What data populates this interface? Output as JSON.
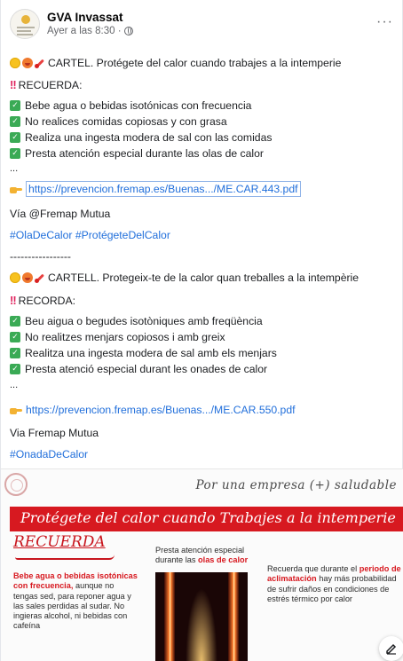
{
  "header": {
    "page_name": "GVA Invassat",
    "timestamp": "Ayer a las 8:30 ·",
    "more": "···"
  },
  "post": {
    "es": {
      "title": "CARTEL. Protégete del calor cuando trabajes a la intemperie",
      "remember": "RECUERDA:",
      "items": [
        "Bebe agua o bebidas isotónicas con frecuencia",
        "No realices comidas copiosas y con grasa",
        "Realiza una ingesta modera de sal con las comidas",
        "Presta atención especial durante las olas de calor"
      ],
      "ellipsis": "...",
      "link": "https://prevencion.fremap.es/Buenas.../ME.CAR.443.pdf",
      "via": "Vía @Fremap Mutua",
      "hashtags": "#OlaDeCalor #ProtégeteDelCalor"
    },
    "separator": "-----------------",
    "va": {
      "title": "CARTELL. Protegeix-te de la calor quan treballes a la intempèrie",
      "remember": "RECORDA:",
      "items": [
        "Beu aigua o begudes isotòniques amb freqüència",
        "No realitzes menjars copiosos i amb greix",
        "Realitza una ingesta modera de sal amb els menjars",
        "Presta atenció especial durant les onades de calor"
      ],
      "ellipsis": "...",
      "link": "https://prevencion.fremap.es/Buenas.../ME.CAR.550.pdf",
      "via": "Via Fremap Mutua",
      "hashtags": "#OnadaDeCalor"
    }
  },
  "poster": {
    "tagline": "Por una empresa (+) saludable",
    "banner": "Protégete del calor cuando Trabajes a la intemperie",
    "recuerda": "RECUERDA",
    "left_bold": "Bebe agua o bebidas isotónicas con frecuencia,",
    "left_text": "aunque no tengas sed, para reponer agua y las sales perdidas al sudar. No ingieras alcohol, ni bebidas con cafeína",
    "mid_text": "Presta atención especial durante las",
    "mid_bold": "olas de calor",
    "right_text_1": "Recuerda que durante el",
    "right_bold": "periodo de aclimatación",
    "right_text_2": "hay más probabilidad de sufrir daños en condiciones de estrés térmico por calor"
  },
  "colors": {
    "link": "#216fdb",
    "check": "#3aaa55",
    "banner_red": "#d71920"
  },
  "icons": [
    "avatar",
    "globe-icon",
    "more-icon",
    "sun-emoji",
    "hot-face-emoji",
    "thermometer-emoji",
    "double-exclamation-icon",
    "check-icon",
    "pointing-hand-icon",
    "edit-icon"
  ]
}
